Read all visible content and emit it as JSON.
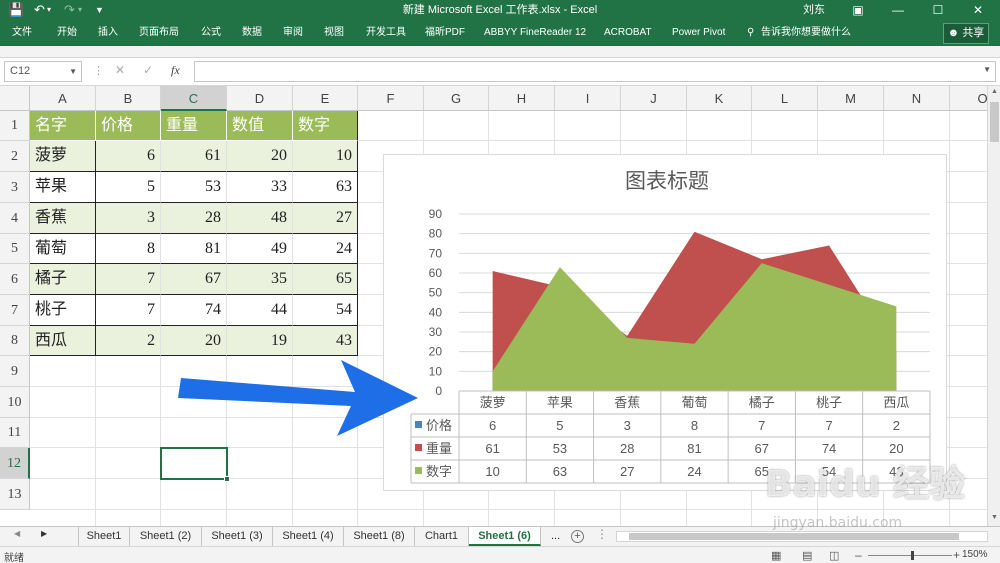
{
  "window": {
    "title": "新建 Microsoft Excel 工作表.xlsx  -  Excel",
    "user": "刘东"
  },
  "ribbon": {
    "tabs": [
      "文件",
      "开始",
      "插入",
      "页面布局",
      "公式",
      "数据",
      "审阅",
      "视图",
      "开发工具",
      "福昕PDF",
      "ABBYY FineReader 12",
      "ACROBAT",
      "Power Pivot",
      "告诉我你想要做什么"
    ],
    "share": "共享"
  },
  "formula_bar": {
    "name_box": "C12",
    "fx": "fx",
    "value": ""
  },
  "columns": [
    "A",
    "B",
    "C",
    "D",
    "E",
    "F",
    "G",
    "H",
    "I",
    "J",
    "K",
    "L",
    "M",
    "N",
    "O"
  ],
  "rows": [
    "1",
    "2",
    "3",
    "4",
    "5",
    "6",
    "7",
    "8",
    "9",
    "10",
    "11",
    "12",
    "13"
  ],
  "table": {
    "headers": [
      "名字",
      "价格",
      "重量",
      "数值",
      "数字"
    ],
    "rows": [
      [
        "菠萝",
        "6",
        "61",
        "20",
        "10"
      ],
      [
        "苹果",
        "5",
        "53",
        "33",
        "63"
      ],
      [
        "香蕉",
        "3",
        "28",
        "48",
        "27"
      ],
      [
        "葡萄",
        "8",
        "81",
        "49",
        "24"
      ],
      [
        "橘子",
        "7",
        "67",
        "35",
        "65"
      ],
      [
        "桃子",
        "7",
        "74",
        "44",
        "54"
      ],
      [
        "西瓜",
        "2",
        "20",
        "19",
        "43"
      ]
    ]
  },
  "chart_data": {
    "type": "area",
    "title": "图表标题",
    "categories": [
      "菠萝",
      "苹果",
      "香蕉",
      "葡萄",
      "橘子",
      "桃子",
      "西瓜"
    ],
    "ylim": [
      0,
      90
    ],
    "yticks": [
      "0",
      "10",
      "20",
      "30",
      "40",
      "50",
      "60",
      "70",
      "80",
      "90"
    ],
    "grid": true,
    "legend": "data-table",
    "series": [
      {
        "name": "价格",
        "color": "#4f81bd",
        "values": [
          6,
          5,
          3,
          8,
          7,
          7,
          2
        ]
      },
      {
        "name": "重量",
        "color": "#c0504d",
        "values": [
          61,
          53,
          28,
          81,
          67,
          74,
          20
        ]
      },
      {
        "name": "数字",
        "color": "#9bbb59",
        "values": [
          10,
          63,
          27,
          24,
          65,
          54,
          43
        ]
      }
    ]
  },
  "sheets": {
    "tabs": [
      "Sheet1",
      "Sheet1 (2)",
      "Sheet1 (3)",
      "Sheet1 (4)",
      "Sheet1 (8)",
      "Chart1",
      "Sheet1 (6)"
    ],
    "active": "Sheet1 (6)",
    "more": "..."
  },
  "status": {
    "ready": "就绪",
    "zoom": "150%"
  },
  "watermark": {
    "logo": "Baidu 经验",
    "url": "jingyan.baidu.com"
  },
  "colors": {
    "excel_green": "#217346",
    "table_header": "#9bbb59",
    "table_band": "#eaf1dd",
    "arrow": "#1e6ee8"
  }
}
